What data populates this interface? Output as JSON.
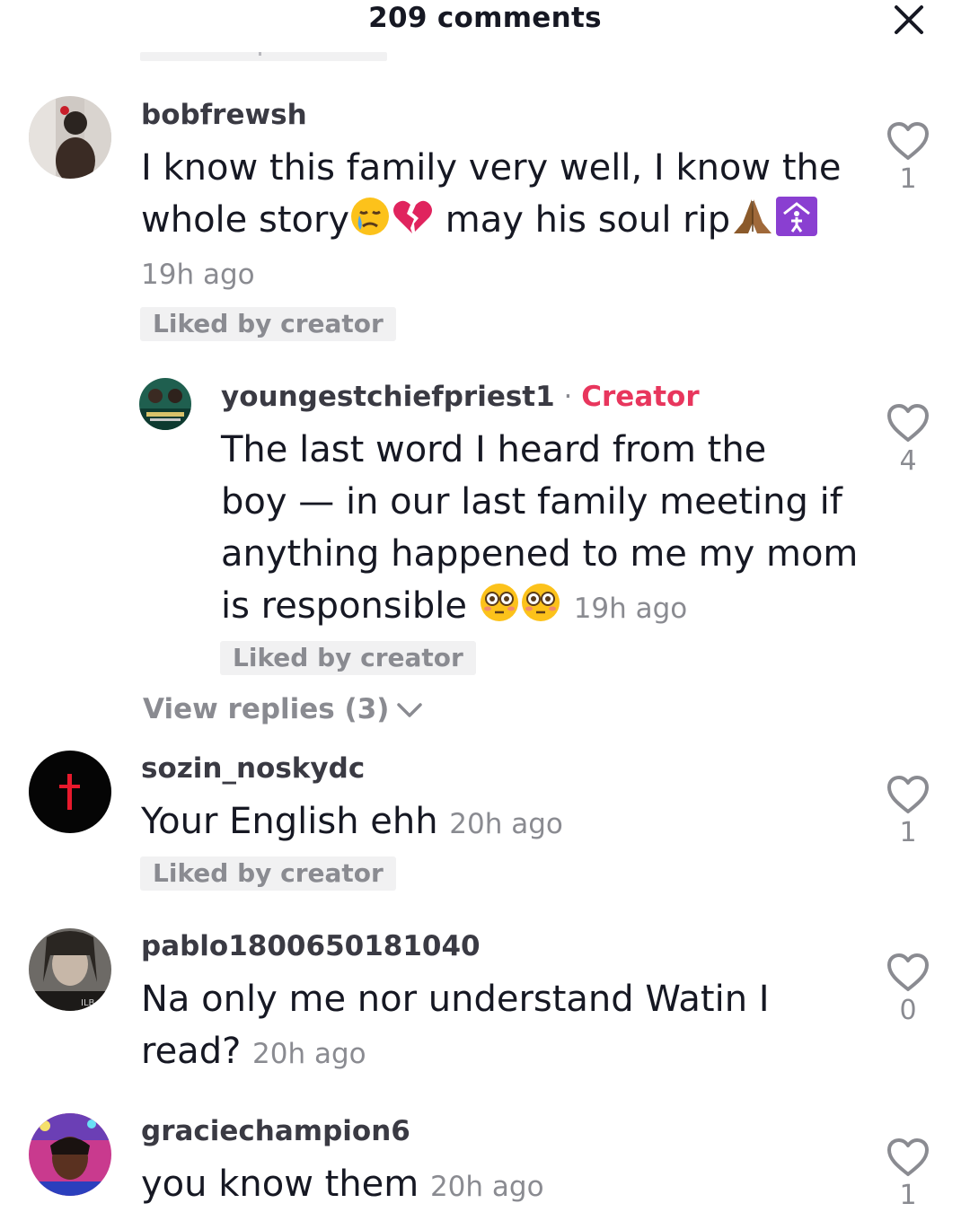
{
  "header": {
    "title": "209 comments",
    "close_icon": "close-icon"
  },
  "comments": [
    {
      "username": "bobfrewsh",
      "text_line1": "I know this family very well, I know the",
      "text_line2_a": "whole story",
      "text_line2_b": " may his soul rip",
      "time": "19h ago",
      "liked_badge": "Liked by creator",
      "likes": "1",
      "emoji": [
        "sad-crying-face-icon",
        "broken-heart-icon",
        "praying-hands-icon",
        "person-in-house-icon"
      ]
    },
    {
      "username": "youngestchiefpriest1",
      "separator": " · ",
      "creator_label": "Creator",
      "text_lines": [
        "The last word I heard from the",
        "boy — in our last family meeting if",
        "anything happened to me my mom"
      ],
      "text_line4": "is responsible ",
      "time": "19h ago",
      "liked_badge": "Liked by creator",
      "likes": "4",
      "emoji": [
        "flushed-face-icon",
        "flushed-face-icon"
      ]
    },
    {
      "username": "sozin_noskydc",
      "text": "Your English ehh ",
      "time": "20h ago",
      "liked_badge": "Liked by creator",
      "likes": "1"
    },
    {
      "username": "pablo1800650181040",
      "text_line1": "Na only me nor understand Watin I",
      "text_line2": "read? ",
      "time": "20h ago",
      "likes": "0"
    },
    {
      "username": "graciechampion6",
      "text": "you know them ",
      "time": "20h ago",
      "likes": "1"
    }
  ],
  "view_replies": {
    "label": "View replies (3)",
    "icon": "chevron-down-icon"
  },
  "colors": {
    "creator": "#e8365d",
    "muted": "#8a8b91",
    "text": "#161823",
    "badge_bg": "#f1f1f2"
  }
}
